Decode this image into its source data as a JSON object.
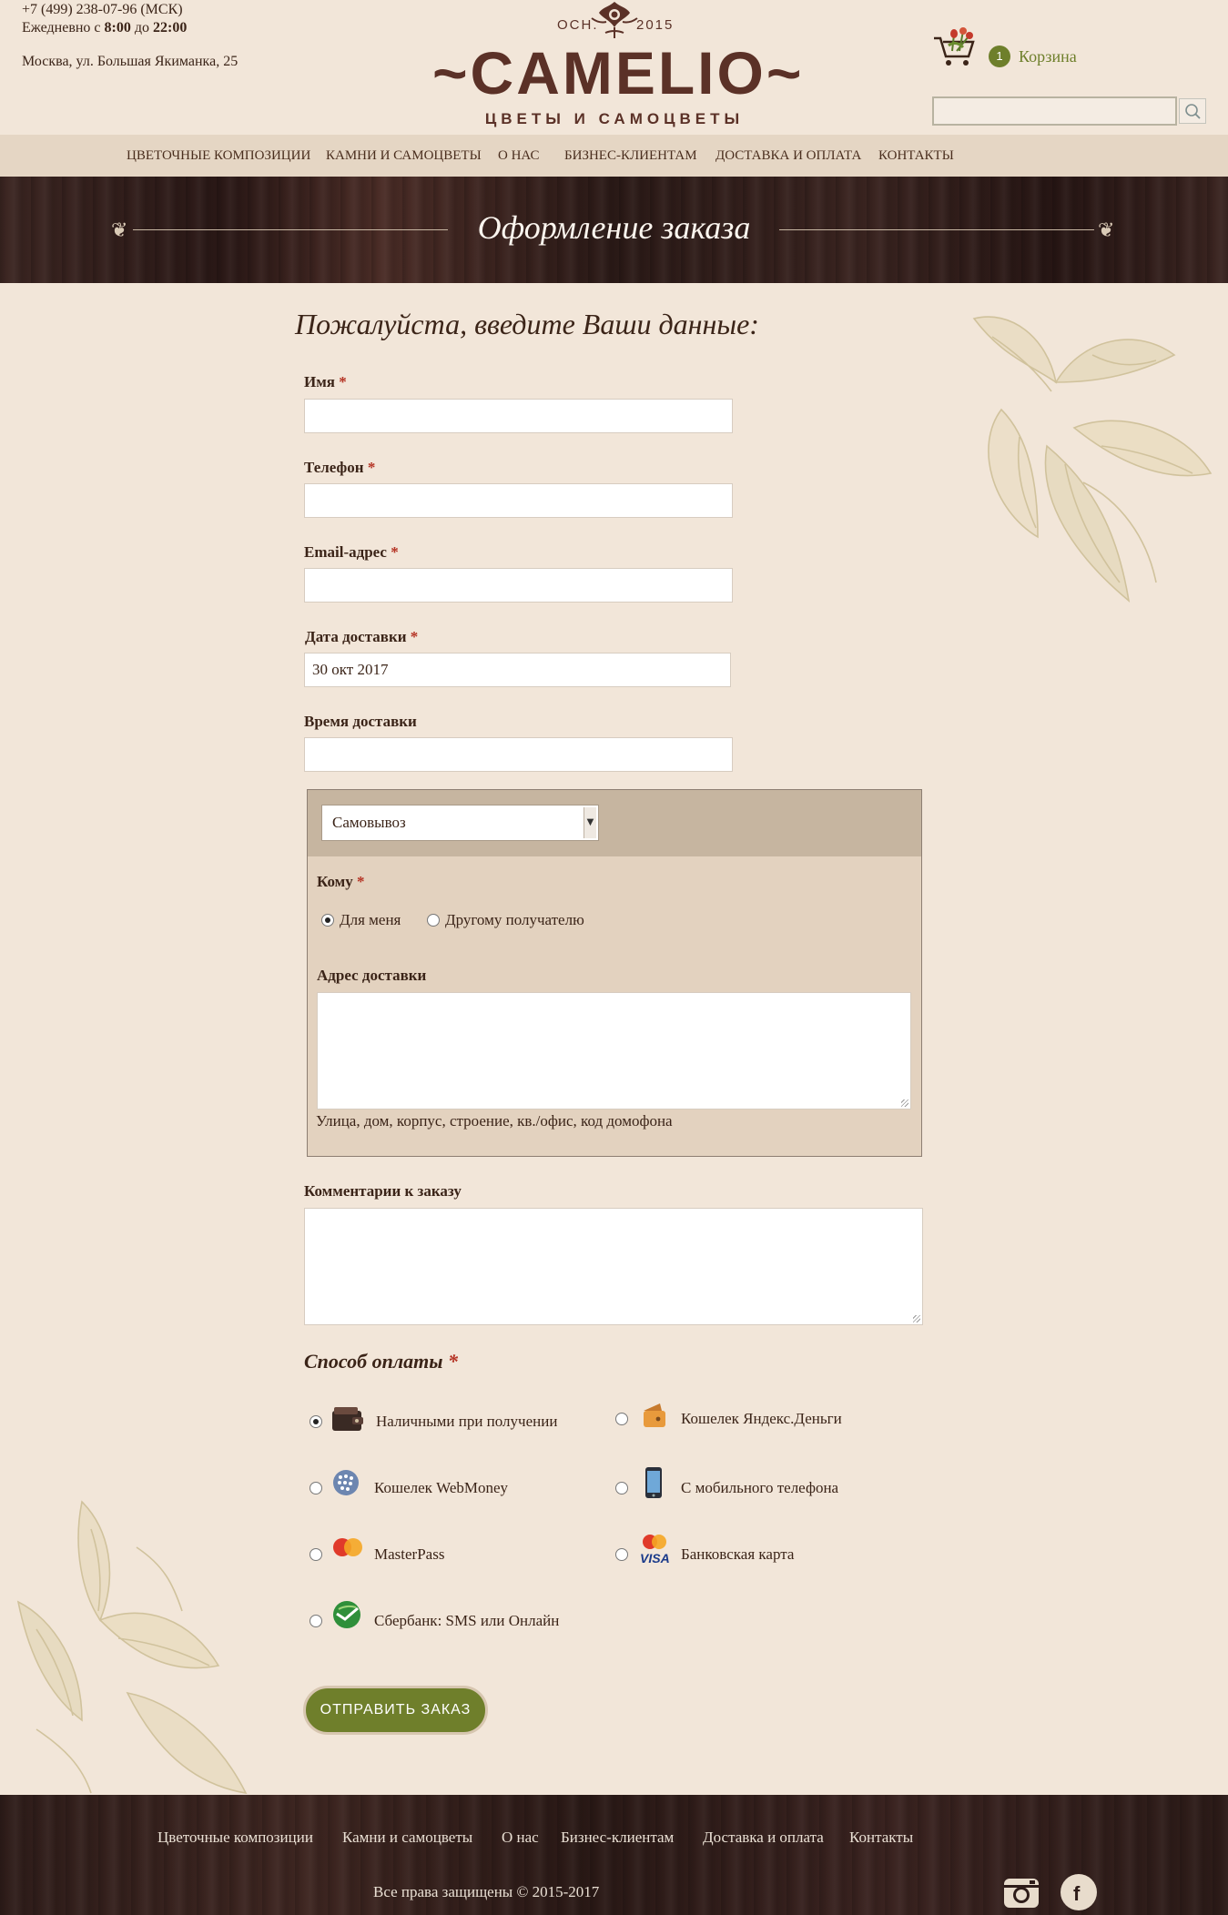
{
  "header": {
    "phone": "+7 (499) 238-07-96 (МСК)",
    "hours_prefix": "Ежедневно с ",
    "hours_open": "8:00",
    "hours_mid": " до ",
    "hours_close": "22:00",
    "address": "Москва, ул. Большая Якиманка, 25",
    "logo_est_left": "ОСН.",
    "logo_est_right": "2015",
    "logo_name": "~CAMELIO~",
    "logo_tagline": "ЦВЕТЫ И САМОЦВЕТЫ",
    "cart_count": "1",
    "cart_label": "Корзина",
    "search_value": "",
    "search_icon": "search-icon",
    "cart_icon": "cart-with-flowers-icon"
  },
  "nav": {
    "items": [
      {
        "label": "Цветочные композиции"
      },
      {
        "label": "Камни и самоцветы"
      },
      {
        "label": "О нас"
      },
      {
        "label": "Бизнес-клиентам"
      },
      {
        "label": "Доставка и оплата"
      },
      {
        "label": "Контакты"
      }
    ]
  },
  "banner": {
    "title": "Оформление заказа"
  },
  "form": {
    "heading": "Пожалуйста, введите Ваши данные:",
    "required_mark": "*",
    "name_label": "Имя",
    "name_value": "",
    "phone_label": "Телефон",
    "phone_value": "",
    "email_label": "Email-адрес",
    "email_value": "",
    "date_label": "Дата доставки",
    "date_value": "30 окт 2017",
    "time_label": "Время доставки",
    "time_value": "",
    "delivery_method": "Самовывоз",
    "recipient_label": "Кому",
    "recipient_options": [
      {
        "label": "Для меня",
        "selected": true
      },
      {
        "label": "Другому получателю",
        "selected": false
      }
    ],
    "address_label": "Адрес доставки",
    "address_value": "",
    "address_hint": "Улица, дом, корпус, строение, кв./офис, код домофона",
    "comment_label": "Комментарии к заказу",
    "comment_value": "",
    "payment_title": "Способ оплаты",
    "payment_options": [
      {
        "label": "Наличными при получении",
        "icon": "wallet-icon",
        "selected": true
      },
      {
        "label": "Кошелек Яндекс.Деньги",
        "icon": "yandex-money-icon",
        "selected": false
      },
      {
        "label": "Кошелек WebMoney",
        "icon": "webmoney-globe-icon",
        "selected": false
      },
      {
        "label": "С мобильного телефона",
        "icon": "mobile-phone-icon",
        "selected": false
      },
      {
        "label": "MasterPass",
        "icon": "masterpass-icon",
        "selected": false
      },
      {
        "label": "Банковская карта",
        "icon": "visa-mastercard-icon",
        "selected": false
      },
      {
        "label": "Сбербанк: SMS или Онлайн",
        "icon": "sberbank-icon",
        "selected": false
      }
    ],
    "submit_label": "ОТПРАВИТЬ ЗАКАЗ"
  },
  "footer": {
    "links": [
      {
        "label": "Цветочные композиции"
      },
      {
        "label": "Камни и самоцветы"
      },
      {
        "label": "О нас"
      },
      {
        "label": "Бизнес-клиентам"
      },
      {
        "label": "Доставка и оплата"
      },
      {
        "label": "Контакты"
      }
    ],
    "copyright": "Все права защищены © 2015-2017",
    "social_icons": [
      "instagram-icon",
      "facebook-icon"
    ]
  },
  "colors": {
    "page_bg": "#f2e6d9",
    "nav_bg": "#e5d6c4",
    "accent_green": "#6f7f2b",
    "brand_brown": "#5b3127",
    "required_red": "#b53324"
  }
}
